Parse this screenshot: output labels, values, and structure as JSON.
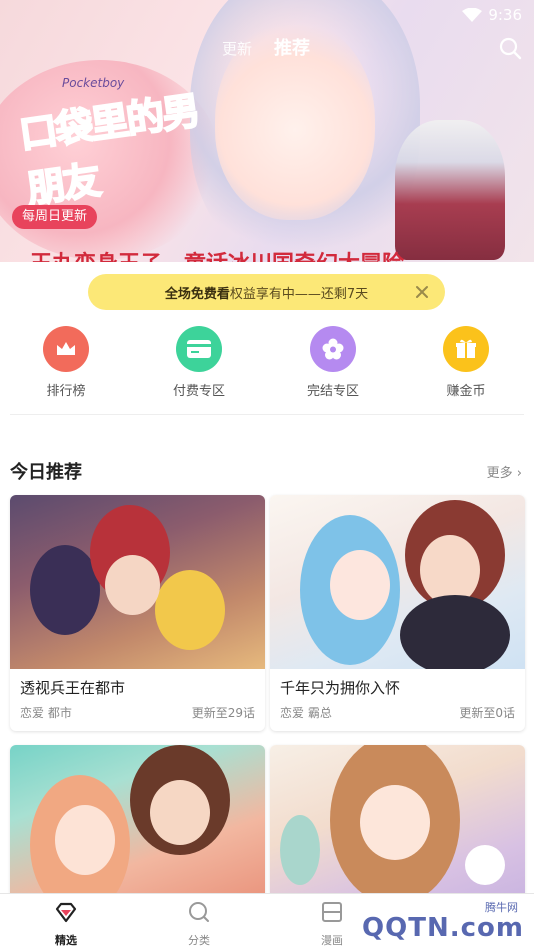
{
  "status": {
    "time": "9:36"
  },
  "header": {
    "tab_update": "更新",
    "tab_recommend": "推荐"
  },
  "banner": {
    "comic_title": "口袋里的男朋友",
    "title_en": "Pocketboy",
    "badge": "每周日更新",
    "subtitle": "王丸变身王子，童话冰川国奇幻大冒险"
  },
  "notice": {
    "bold": "全场免费看",
    "text": "权益享有中——还剩7天"
  },
  "quick": [
    {
      "label": "排行榜",
      "icon": "crown-icon",
      "color": "#f26b5b"
    },
    {
      "label": "付费专区",
      "icon": "card-icon",
      "color": "#3dd39a"
    },
    {
      "label": "完结专区",
      "icon": "flower-icon",
      "color": "#b58af0"
    },
    {
      "label": "赚金币",
      "icon": "gift-icon",
      "color": "#fbc21b"
    }
  ],
  "section": {
    "title": "今日推荐",
    "more": "更多"
  },
  "cards": [
    {
      "title": "透视兵王在都市",
      "tags": "恋爱 都市",
      "update": "更新至29话"
    },
    {
      "title": "千年只为拥你入怀",
      "tags": "恋爱 霸总",
      "update": "更新至0话"
    }
  ],
  "nav": [
    {
      "label": "精选",
      "icon": "featured-icon"
    },
    {
      "label": "分类",
      "icon": "category-icon"
    },
    {
      "label": "漫画",
      "icon": "comic-icon"
    }
  ],
  "watermark": {
    "main": "QQTN.com",
    "small": "腾牛网"
  }
}
